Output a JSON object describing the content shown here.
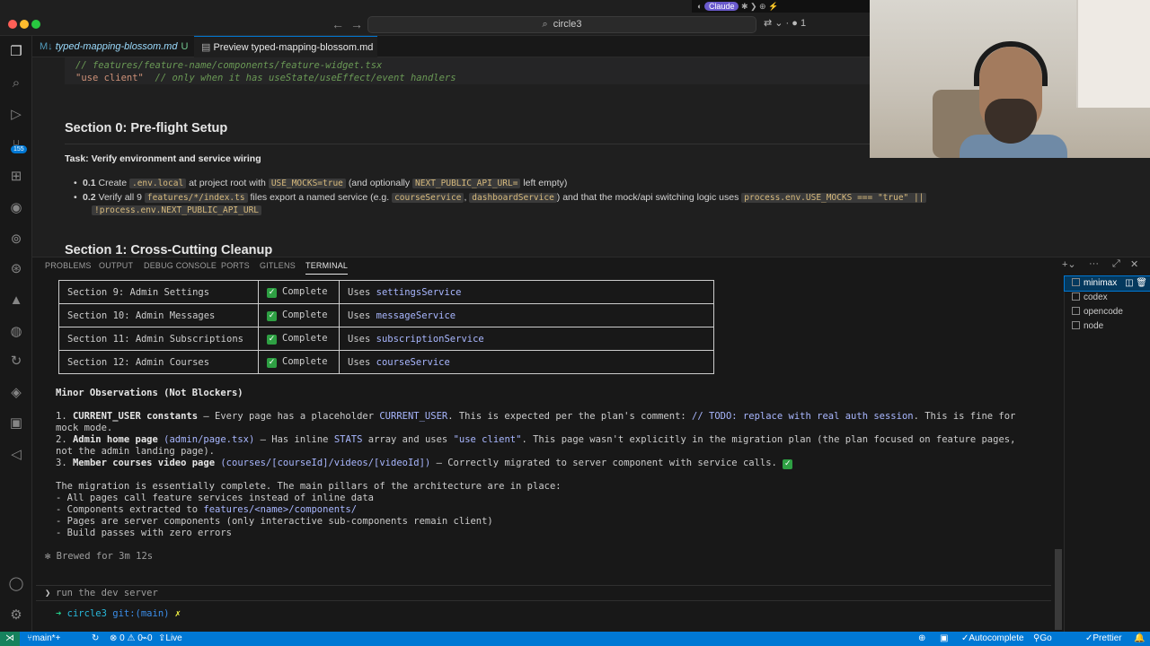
{
  "window": {
    "search_text": "circle3",
    "title_right": "1",
    "menubar_pill": "Claude"
  },
  "activity": {
    "badge": "155"
  },
  "tabs": {
    "markdown_tab": "typed-mapping-blossom.md",
    "markdown_status": "U",
    "preview_tab": "Preview typed-mapping-blossom.md"
  },
  "preview": {
    "code_comment": "// features/feature-name/components/feature-widget.tsx",
    "code_string": "\"use client\"",
    "code_comment2": "// only when it has useState/useEffect/event handlers",
    "section0_title": "Section 0: Pre-flight Setup",
    "task_title": "Task: Verify environment and service wiring",
    "item1": {
      "num": "0.1",
      "t1": "Create",
      "c1": ".env.local",
      "t2": "at project root with",
      "c2": "USE_MOCKS=true",
      "t3": "(and optionally",
      "c3": "NEXT_PUBLIC_API_URL=",
      "t4": "left empty)"
    },
    "item2": {
      "num": "0.2",
      "t1": "Verify all 9",
      "c1": "features/*/index.ts",
      "t2": "files export a named service (e.g.",
      "c2": "courseService",
      "t3": ",",
      "c3": "dashboardService",
      "t4": ") and that the mock/api switching logic uses",
      "c4": "process.env.USE_MOCKS === \"true\" ||",
      "c5": "!process.env.NEXT_PUBLIC_API_URL"
    },
    "section1_title": "Section 1: Cross-Cutting Cleanup"
  },
  "panel": {
    "tabs": [
      "PROBLEMS",
      "OUTPUT",
      "DEBUG CONSOLE",
      "PORTS",
      "GITLENS",
      "TERMINAL"
    ],
    "active_tab": "TERMINAL"
  },
  "terminal": {
    "table": [
      {
        "section": "Section 9: Admin Settings",
        "status": "Complete",
        "uses": "Uses",
        "service": "settingsService"
      },
      {
        "section": "Section 10: Admin Messages",
        "status": "Complete",
        "uses": "Uses",
        "service": "messageService"
      },
      {
        "section": "Section 11: Admin Subscriptions",
        "status": "Complete",
        "uses": "Uses",
        "service": "subscriptionService"
      },
      {
        "section": "Section 12: Admin Courses",
        "status": "Complete",
        "uses": "Uses",
        "service": "courseService"
      }
    ],
    "observations_title": "Minor Observations (Not Blockers)",
    "obs1": {
      "num": "1.",
      "bold": "CURRENT_USER constants",
      "t1": " — Every page has a placeholder ",
      "h1": "CURRENT_USER",
      "t2": ". This is expected per the plan's comment: ",
      "h2": "// TODO: replace with real auth session",
      "t3": ". This is fine for",
      "cont": "mock mode."
    },
    "obs2": {
      "num": "2.",
      "bold": "Admin home page",
      "h1": "(admin/page.tsx)",
      "t1": " — Has inline ",
      "h2": "STATS",
      "t2": " array and uses ",
      "h3": "\"use client\"",
      "t3": ". This page wasn't explicitly in the migration plan (the plan focused on feature pages,",
      "cont": "not the admin landing page)."
    },
    "obs3": {
      "num": "3.",
      "bold": "Member courses video page",
      "h1": "(courses/[courseId]/videos/[videoId])",
      "t1": " — Correctly migrated to server component with service calls."
    },
    "summary": "The migration is essentially complete. The main pillars of the architecture are in place:",
    "bullets": {
      "b1": "- All pages call feature services instead of inline data",
      "b2_pre": "- Components extracted to ",
      "b2_hl": "features/<name>/components/",
      "b3": "- Pages are server components (only interactive sub-components remain client)",
      "b4": "- Build passes with zero errors"
    },
    "brewed": "✻ Brewed for 3m 12s",
    "prompt_arrow": "❯",
    "prompt_text": "run the dev server",
    "shell_arrow": "➜",
    "shell_dir": "circle3",
    "shell_git": "git:(main)",
    "shell_x": "✗"
  },
  "terminal_list": [
    "minimax",
    "codex",
    "opencode",
    "node"
  ],
  "statusbar": {
    "branch": "main*+",
    "problems": "⊗ 0 ⚠ 0",
    "errors0": "0",
    "live_share": "Live Share",
    "autocomplete": "Autocomplete",
    "go_live": "Go Live",
    "prettier": "Prettier"
  },
  "colors": {
    "accent": "#0078d4",
    "check": "#2ea043",
    "service": "#a9b7ff"
  }
}
